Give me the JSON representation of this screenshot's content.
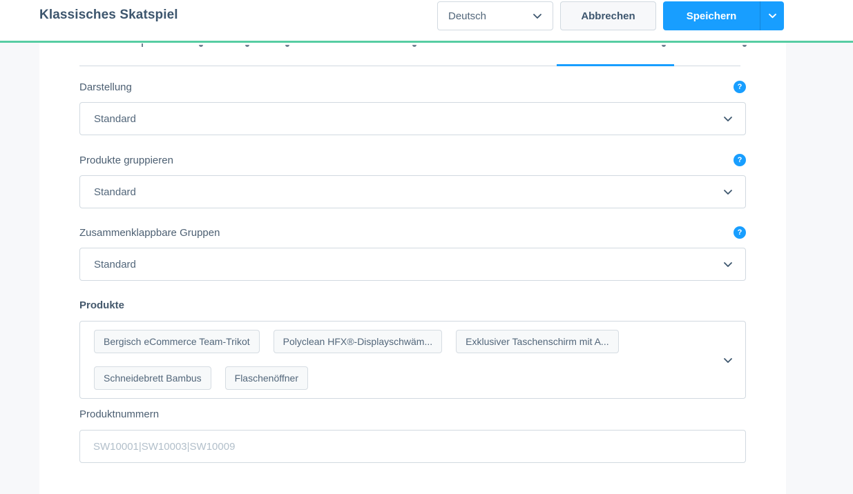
{
  "header": {
    "title": "Klassisches Skatspiel",
    "language": {
      "value": "Deutsch"
    },
    "cancel_label": "Abbrechen",
    "save_label": "Speichern"
  },
  "icons": {
    "help_glyph": "?"
  },
  "colors": {
    "accent_green": "#57cda3",
    "primary_blue": "#189eff",
    "border_gray": "#d1d9e0",
    "page_background": "#f7f8fa"
  },
  "tab_bar": {
    "active_tab_indicator": true
  },
  "form": {
    "fields": [
      {
        "type": "select",
        "label": "Darstellung",
        "value": "Standard",
        "has_help": true
      },
      {
        "type": "select",
        "label": "Produkte gruppieren",
        "value": "Standard",
        "has_help": true
      },
      {
        "type": "select",
        "label": "Zusammenklappbare Gruppen",
        "value": "Standard",
        "has_help": true
      },
      {
        "type": "multiselect",
        "label": "Produkte",
        "tags": [
          "Bergisch eCommerce Team-Trikot",
          "Polyclean HFX®-Displayschwäm...",
          "Exklusiver Taschenschirm mit A...",
          "Schneidebrett Bambus",
          "Flaschenöffner"
        ]
      },
      {
        "type": "text",
        "label": "Produktnummern",
        "value": "",
        "placeholder": "SW10001|SW10003|SW10009"
      }
    ]
  }
}
